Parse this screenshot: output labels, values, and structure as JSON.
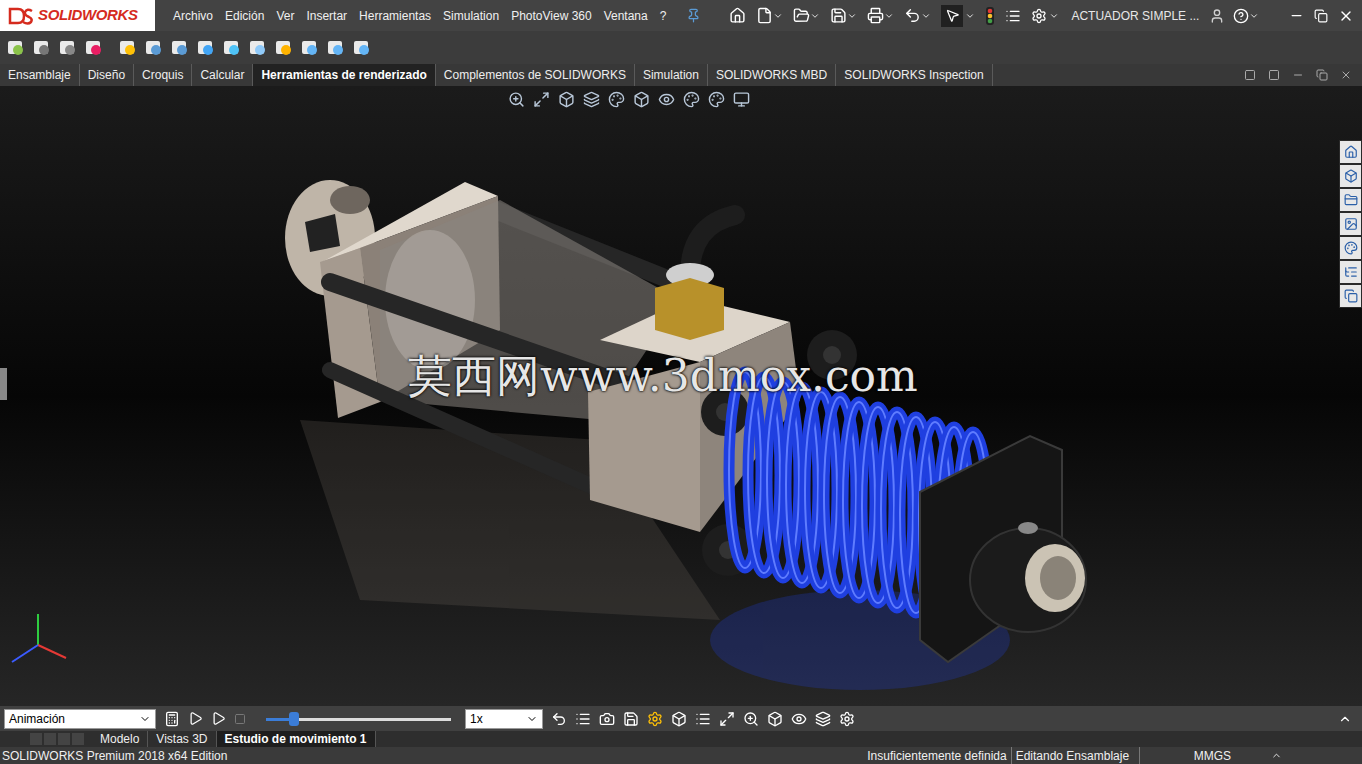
{
  "app": {
    "logo": "SOLIDWORKS",
    "title": "ACTUADOR SIMPLE ..."
  },
  "menu": [
    "Archivo",
    "Edición",
    "Ver",
    "Insertar",
    "Herramientas",
    "Simulation",
    "PhotoView 360",
    "Ventana",
    "?"
  ],
  "command_tabs": [
    {
      "label": "Ensamblaje",
      "selected": false
    },
    {
      "label": "Diseño",
      "selected": false
    },
    {
      "label": "Croquis",
      "selected": false
    },
    {
      "label": "Calcular",
      "selected": false
    },
    {
      "label": "Herramientas de renderizado",
      "selected": true
    },
    {
      "label": "Complementos de SOLIDWORKS",
      "selected": false
    },
    {
      "label": "Simulation",
      "selected": false
    },
    {
      "label": "SOLIDWORKS MBD",
      "selected": false
    },
    {
      "label": "SOLIDWORKS Inspection",
      "selected": false
    }
  ],
  "viewport": {
    "watermark": "莫西网www.3dmox.com"
  },
  "motion_study": {
    "type": "Animación",
    "timeline_level": 0.15,
    "speed": "1x"
  },
  "model_tabs": [
    {
      "label": "Modelo",
      "selected": false
    },
    {
      "label": "Vistas 3D",
      "selected": false
    },
    {
      "label": "Estudio de movimiento 1",
      "selected": true
    }
  ],
  "status_bar": {
    "product": "SOLIDWORKS Premium 2018 x64 Edition",
    "definition": "Insuficientemente definida",
    "mode": "Editando Ensamblaje",
    "units": "MMGS"
  }
}
